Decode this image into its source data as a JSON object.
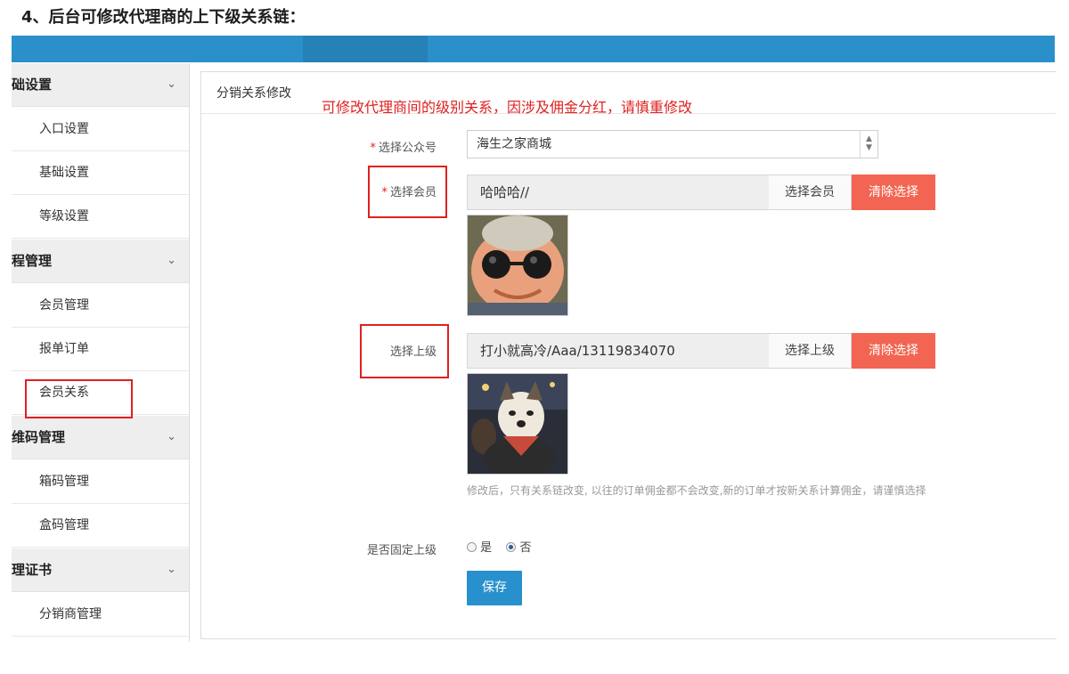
{
  "doc_heading": "4、后台可修改代理商的上下级关系链：",
  "sidebar": {
    "groups": [
      {
        "label": "础设置",
        "items": [
          "入口设置",
          "基础设置",
          "等级设置"
        ]
      },
      {
        "label": "程管理",
        "items": [
          "会员管理",
          "报单订单",
          "会员关系"
        ]
      },
      {
        "label": "维码管理",
        "items": [
          "箱码管理",
          "盒码管理"
        ]
      },
      {
        "label": "理证书",
        "items": [
          "分销商管理"
        ]
      }
    ],
    "chevron_icon": "chevron-down-icon"
  },
  "panel": {
    "title": "分销关系修改",
    "note": "可修改代理商间的级别关系，因涉及佣金分红，请慎重修改"
  },
  "form": {
    "account": {
      "label": "选择公众号",
      "value": "海生之家商城"
    },
    "member": {
      "label": "选择会员",
      "value": "哈哈哈//",
      "pick_label": "选择会员",
      "clear_label": "清除选择"
    },
    "superior": {
      "label": "选择上级",
      "value": "打小就高冷/Aaa/13119834070",
      "pick_label": "选择上级",
      "clear_label": "清除选择"
    },
    "help_text": "修改后，只有关系链改变, 以往的订单佣金都不会改变,新的订单才按新关系计算佣金，请谨慎选择",
    "fixed": {
      "label": "是否固定上级",
      "options": [
        "是",
        "否"
      ],
      "selected": "否"
    },
    "save_label": "保存"
  },
  "colors": {
    "topbar": "#2b8fc9",
    "accent_red": "#e02020",
    "clear_button": "#f26552",
    "save_button": "#2891cd"
  }
}
